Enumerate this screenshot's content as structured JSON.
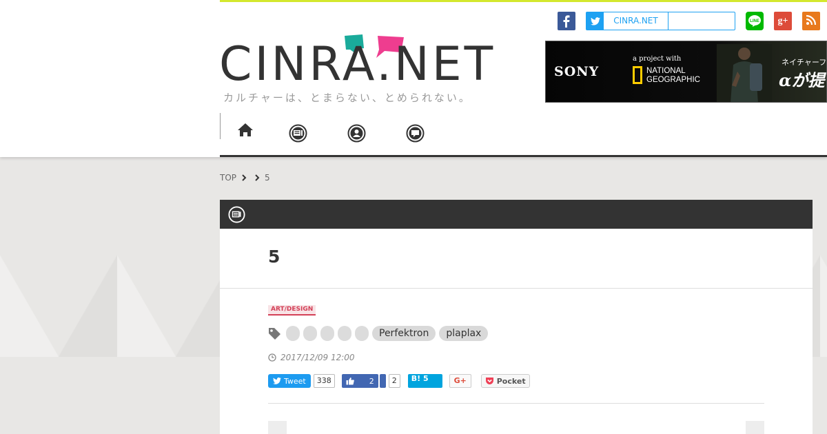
{
  "site": {
    "logo_text": "CINRA.NET",
    "tagline": "カルチャーは、とまらない、とめられない。",
    "colors": {
      "accent_line": "#d4e82e",
      "logo_teal": "#1aab9b",
      "logo_pink": "#ee3d8f"
    }
  },
  "social": {
    "facebook_icon": "facebook-icon",
    "twitter_name": "CINRA.NET",
    "line_label": "LINE",
    "gplus_label": "g+",
    "rss_icon": "rss-icon"
  },
  "ad": {
    "brand": "SONY",
    "project_text": "a project with",
    "partner_line1": "NATIONAL",
    "partner_line2": "GEOGRAPHIC",
    "jp_text": "ネイチャーフォ",
    "headline": "αが提"
  },
  "nav": {
    "items": [
      {
        "icon": "home-icon"
      },
      {
        "icon": "news-icon"
      },
      {
        "icon": "people-icon"
      },
      {
        "icon": "chat-icon"
      }
    ]
  },
  "breadcrumb": {
    "top": "TOP",
    "current": "5"
  },
  "article": {
    "section_icon": "news-icon",
    "title": "5",
    "category": "ART/DESIGN",
    "tags": [
      "Perfektron",
      "plaplax"
    ],
    "date": "2017/12/09 12:00",
    "share": {
      "tweet_label": "Tweet",
      "tweet_count": "338",
      "fb_like_count": "2",
      "fb_share_count": "2",
      "hatena_label": "B!",
      "hatena_count": "5",
      "gplus_label": "G+",
      "pocket_label": "Pocket"
    }
  }
}
